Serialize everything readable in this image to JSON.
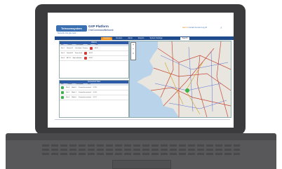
{
  "app": {
    "logo_text": "Telecomsystem",
    "logo_sub": "Networks that give back",
    "product_title": "GXP Platform",
    "product_sub": "OneCommandNetwork",
    "top_links": [
      "Alarms",
      "Contact",
      "Account",
      "Log off"
    ],
    "help_icon": "help-icon"
  },
  "nav": {
    "tabs": [
      "Overview",
      "Devices",
      "Alerts",
      "Reports",
      "System Settings"
    ],
    "active_tab_index": 0,
    "right_button": "Search"
  },
  "panel_top": {
    "title": "Alarms",
    "columns": [
      "Site",
      "Device",
      "Description",
      "State",
      "Time"
    ],
    "rows": [
      {
        "site": "Site 1",
        "device": "Router-01",
        "desc": "Link down - Primary",
        "state": "red",
        "time": "08:42"
      },
      {
        "site": "Site 2",
        "device": "Switch-04",
        "desc": "Power fault",
        "state": "red",
        "time": "08:31"
      },
      {
        "site": "Site 3",
        "device": "AP-12",
        "desc": "High utilization",
        "state": "red",
        "time": "08:10"
      }
    ]
  },
  "panel_bottom": {
    "title": "Connected Sites",
    "columns": [
      "Site",
      "Device",
      "Description",
      "Time"
    ],
    "rows": [
      {
        "site": "Site 4",
        "device": "Node-2",
        "desc": "Connection restored",
        "state": "green",
        "time": "07:58"
      },
      {
        "site": "Site 5",
        "device": "Node-7",
        "desc": "Connection restored",
        "state": "green",
        "time": "07:44"
      },
      {
        "site": "Site 6",
        "device": "Node-9",
        "desc": "Connection restored",
        "state": "green",
        "time": "07:21"
      }
    ]
  },
  "map": {
    "tools": [
      "+",
      "−",
      "⌂"
    ],
    "colors": {
      "sea": "#b9d3ea",
      "land": "#e9e6df",
      "roads": "#c44a3a",
      "lines": "#5a6fd1"
    }
  }
}
